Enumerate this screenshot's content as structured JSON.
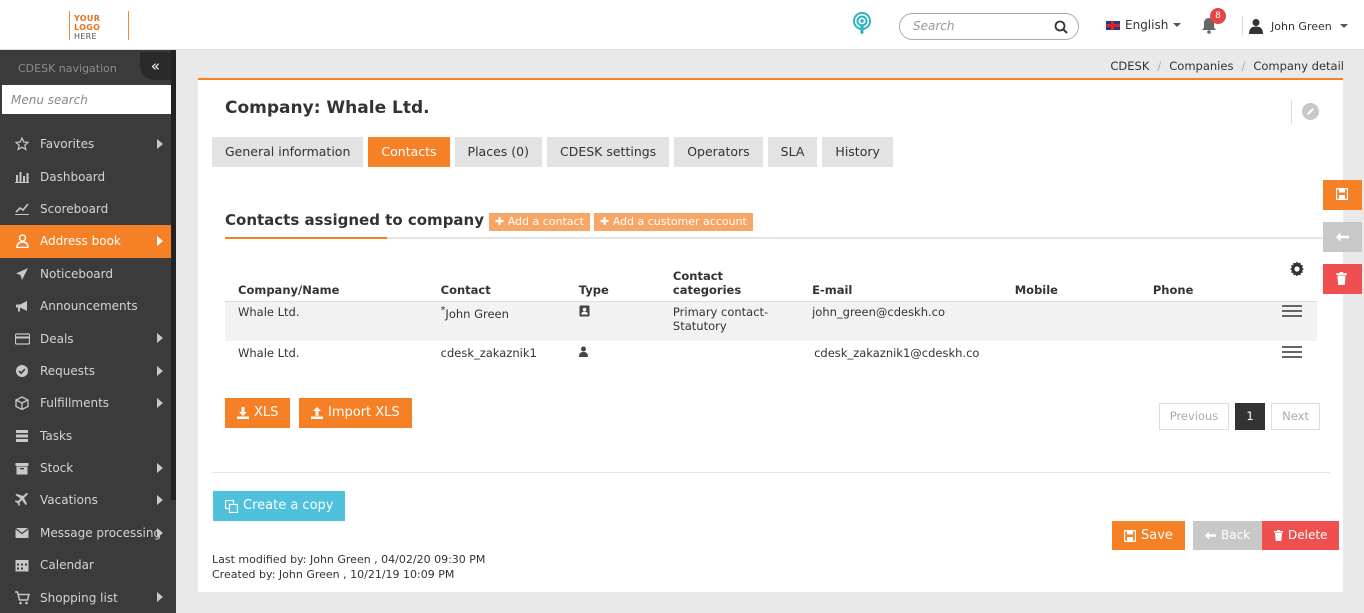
{
  "header": {
    "logo_line1": "YOUR LOGO",
    "logo_line2": "HERE",
    "search_placeholder": "Search",
    "language": "English",
    "notification_count": "8",
    "user_name": "John Green"
  },
  "sidebar": {
    "title": "CDESK navigation",
    "collapse_icon": "«",
    "menu_search_placeholder": "Menu search",
    "items": [
      {
        "label": "Favorites",
        "icon": "star-icon",
        "arrow": true
      },
      {
        "label": "Dashboard",
        "icon": "bar-chart-icon",
        "arrow": false
      },
      {
        "label": "Scoreboard",
        "icon": "line-chart-icon",
        "arrow": false
      },
      {
        "label": "Address book",
        "icon": "user-icon",
        "arrow": true,
        "active": true
      },
      {
        "label": "Noticeboard",
        "icon": "paper-plane-icon",
        "arrow": false
      },
      {
        "label": "Announcements",
        "icon": "megaphone-icon",
        "arrow": false
      },
      {
        "label": "Deals",
        "icon": "credit-card-icon",
        "arrow": true
      },
      {
        "label": "Requests",
        "icon": "check-circle-icon",
        "arrow": true
      },
      {
        "label": "Fulfillments",
        "icon": "cube-icon",
        "arrow": true
      },
      {
        "label": "Tasks",
        "icon": "tasks-icon",
        "arrow": false
      },
      {
        "label": "Stock",
        "icon": "archive-icon",
        "arrow": true
      },
      {
        "label": "Vacations",
        "icon": "plane-icon",
        "arrow": true
      },
      {
        "label": "Message processing",
        "icon": "envelope-icon",
        "arrow": true
      },
      {
        "label": "Calendar",
        "icon": "calendar-icon",
        "arrow": false
      },
      {
        "label": "Shopping list",
        "icon": "cart-icon",
        "arrow": true
      }
    ]
  },
  "breadcrumb": [
    "CDESK",
    "Companies",
    "Company detail"
  ],
  "page": {
    "title": "Company: Whale Ltd.",
    "tabs": [
      {
        "label": "General information",
        "active": false
      },
      {
        "label": "Contacts",
        "active": true
      },
      {
        "label": "Places (0)",
        "active": false
      },
      {
        "label": "CDESK settings",
        "active": false
      },
      {
        "label": "Operators",
        "active": false
      },
      {
        "label": "SLA",
        "active": false
      },
      {
        "label": "History",
        "active": false
      }
    ],
    "section_title": "Contacts assigned to company",
    "add_contact_label": "Add a contact",
    "add_customer_account_label": "Add a customer account"
  },
  "table": {
    "columns": [
      "Company/Name",
      "Contact",
      "Type",
      "Contact categories",
      "E-mail",
      "Mobile",
      "Phone"
    ],
    "rows": [
      {
        "company": "Whale Ltd.",
        "contact_marker": "*",
        "contact": "John Green",
        "type_icon": "contact-card-icon",
        "categories": "Primary contact- Statutory",
        "email": "john_green@cdeskh.co",
        "mobile": "",
        "phone": ""
      },
      {
        "company": "Whale Ltd.",
        "contact_marker": "",
        "contact": "cdesk_zakaznik1",
        "type_icon": "user-icon",
        "categories": "",
        "email": "cdesk_zakaznik1@cdeskh.co",
        "mobile": "",
        "phone": ""
      }
    ]
  },
  "actions": {
    "xls_label": "XLS",
    "import_xls_label": "Import XLS",
    "copy_label": "Create a copy",
    "save_label": "Save",
    "back_label": "Back",
    "delete_label": "Delete"
  },
  "pagination": {
    "previous": "Previous",
    "current": "1",
    "next": "Next"
  },
  "meta": {
    "modified": "Last modified by: John Green , 04/02/20 09:30 PM",
    "created": "Created by: John Green , 10/21/19 10:09 PM"
  },
  "colors": {
    "accent": "#f58025",
    "copy": "#4fc1dc",
    "delete": "#ef4f4f",
    "sidebar": "#3b3b3b"
  }
}
